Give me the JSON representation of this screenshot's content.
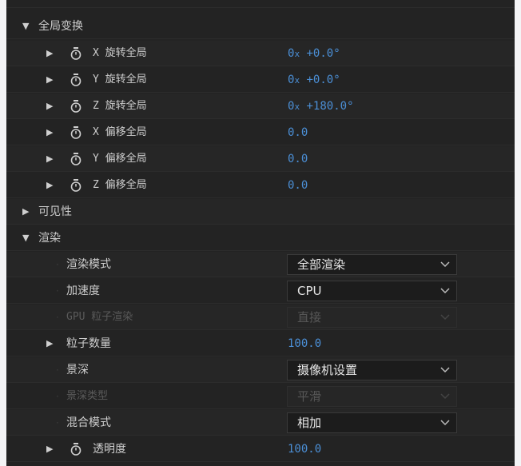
{
  "sections": {
    "global_transform": "全局变换",
    "visibility": "可见性",
    "render": "渲染"
  },
  "transform_rows": [
    {
      "label": "X 旋转全局",
      "value_prefix": "0",
      "value_x": "x",
      "value_rest": "+0.0°"
    },
    {
      "label": "Y 旋转全局",
      "value_prefix": "0",
      "value_x": "x",
      "value_rest": "+0.0°"
    },
    {
      "label": "Z 旋转全局",
      "value_prefix": "0",
      "value_x": "x",
      "value_rest": "+180.0°"
    },
    {
      "label": "X 偏移全局",
      "value": "0.0"
    },
    {
      "label": "Y 偏移全局",
      "value": "0.0"
    },
    {
      "label": "Z 偏移全局",
      "value": "0.0"
    }
  ],
  "render_rows": {
    "render_mode": {
      "label": "渲染模式",
      "selected": "全部渲染"
    },
    "acceleration": {
      "label": "加速度",
      "selected": "CPU"
    },
    "gpu_particle_render": {
      "label": "GPU 粒子渲染",
      "selected": "直接"
    },
    "particle_count": {
      "label": "粒子数量",
      "value": "100.0"
    },
    "depth_of_field": {
      "label": "景深",
      "selected": "摄像机设置"
    },
    "dof_type": {
      "label": "景深类型",
      "selected": "平滑"
    },
    "blend_mode": {
      "label": "混合模式",
      "selected": "相加"
    },
    "opacity": {
      "label": "透明度",
      "value": "100.0"
    }
  },
  "colors": {
    "panel_bg": "#232323",
    "value_blue": "#4b8fd6",
    "label": "#cdcdcd",
    "disabled": "#5a5a5a"
  }
}
